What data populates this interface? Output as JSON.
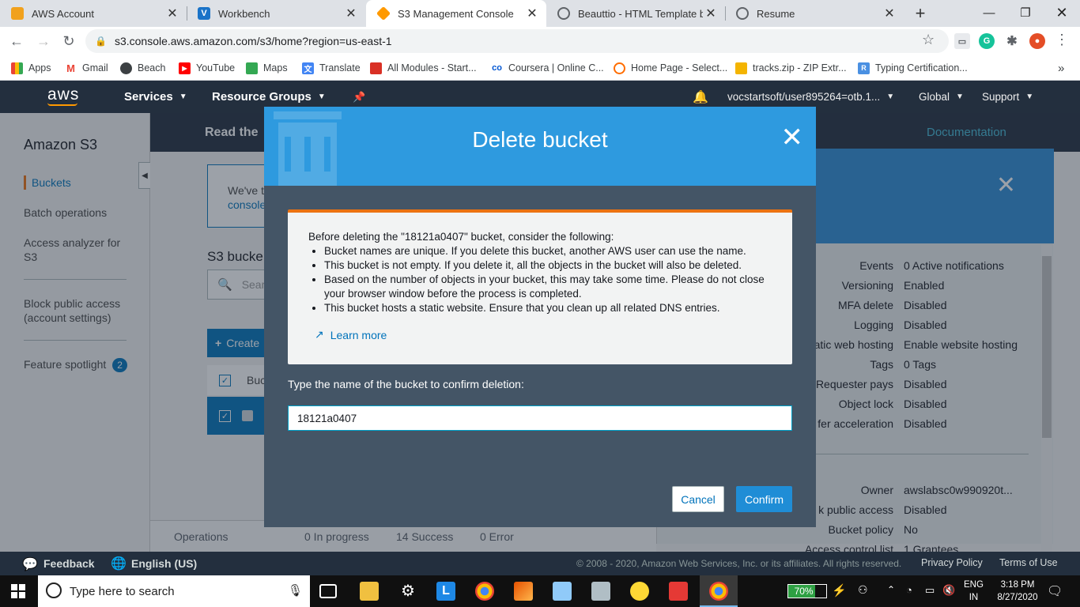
{
  "browser": {
    "tabs": [
      {
        "title": "AWS Account",
        "icon": "aws-cube-icon",
        "color": "#f1a11d"
      },
      {
        "title": "Workbench",
        "icon": "vocareum-icon",
        "color": "#1a73c8"
      },
      {
        "title": "S3 Management Console",
        "icon": "aws-cube-icon",
        "color": "#ff9900"
      },
      {
        "title": "Beauttio - HTML Template by V",
        "icon": "globe-icon",
        "color": "#5f6368"
      },
      {
        "title": "Resume",
        "icon": "globe-icon",
        "color": "#5f6368"
      }
    ],
    "new_tab": "+",
    "url": "s3.console.aws.amazon.com/s3/home?region=us-east-1",
    "bookmarks": [
      {
        "label": "Apps",
        "icon": "apps-grid-icon"
      },
      {
        "label": "Gmail",
        "icon": "gmail-icon"
      },
      {
        "label": "Beach",
        "icon": "globe-icon"
      },
      {
        "label": "YouTube",
        "icon": "youtube-icon"
      },
      {
        "label": "Maps",
        "icon": "maps-icon"
      },
      {
        "label": "Translate",
        "icon": "translate-icon"
      },
      {
        "label": "All Modules - Start...",
        "icon": "modules-icon"
      },
      {
        "label": "Coursera | Online C...",
        "icon": "coursera-icon"
      },
      {
        "label": "Home Page - Select...",
        "icon": "loading-icon"
      },
      {
        "label": "tracks.zip - ZIP Extr...",
        "icon": "zip-icon"
      },
      {
        "label": "Typing Certification...",
        "icon": "typing-icon"
      }
    ],
    "more_bookmarks": "»"
  },
  "aws_header": {
    "logo": "aws",
    "services": "Services",
    "resource_groups": "Resource Groups",
    "account": "vocstartsoft/user895264=otb.1...",
    "region": "Global",
    "support": "Support"
  },
  "sidebar": {
    "title": "Amazon S3",
    "items": [
      "Buckets",
      "Batch operations",
      "Access analyzer for S3",
      "Block public access (account settings)",
      "Feature spotlight"
    ],
    "spotlight_count": "2"
  },
  "main": {
    "banner_title": "Read the",
    "documentation": "Documentation",
    "notice_line1": "We've t",
    "notice_line2": "console",
    "buckets_heading": "S3 bucke",
    "search_placeholder": "Sear",
    "create_button": "Create",
    "col_bucket": "Buc"
  },
  "operations": {
    "label": "Operations",
    "in_progress": "0 In progress",
    "success": "14 Success",
    "error": "0 Error"
  },
  "properties_panel": {
    "rows": [
      {
        "label": "Events",
        "value": "0 Active notifications"
      },
      {
        "label": "Versioning",
        "value": "Enabled"
      },
      {
        "label": "MFA delete",
        "value": "Disabled"
      },
      {
        "label": "Logging",
        "value": "Disabled"
      },
      {
        "label": "atic web hosting",
        "value": "Enable website hosting"
      },
      {
        "label": "Tags",
        "value": "0 Tags"
      },
      {
        "label": "Requester pays",
        "value": "Disabled"
      },
      {
        "label": "Object lock",
        "value": "Disabled"
      },
      {
        "label": "fer acceleration",
        "value": "Disabled"
      }
    ],
    "rows2": [
      {
        "label": "Owner",
        "value": "awslabsc0w990920t..."
      },
      {
        "label": "k public access",
        "value": "Disabled"
      },
      {
        "label": "Bucket policy",
        "value": "No"
      },
      {
        "label": "Access control list",
        "value": "1 Grantees"
      }
    ]
  },
  "modal": {
    "title": "Delete bucket",
    "intro": "Before deleting the \"18121a0407\" bucket, consider the following:",
    "bullets": [
      "Bucket names are unique. If you delete this bucket, another AWS user can use the name.",
      "This bucket is not empty. If you delete it, all the objects in the bucket will also be deleted.",
      "Based on the number of objects in your bucket, this may take some time. Please do not close your browser window before the process is completed.",
      "This bucket hosts a static website. Ensure that you clean up all related DNS entries."
    ],
    "learn_more": "Learn more",
    "confirm_label": "Type the name of the bucket to confirm deletion:",
    "input_value": "18121a0407",
    "cancel": "Cancel",
    "confirm": "Confirm"
  },
  "footer": {
    "feedback": "Feedback",
    "language": "English (US)",
    "copyright": "© 2008 - 2020, Amazon Web Services, Inc. or its affiliates. All rights reserved.",
    "privacy": "Privacy Policy",
    "terms": "Terms of Use"
  },
  "taskbar": {
    "search_placeholder": "Type here to search",
    "battery": "70%",
    "lang1": "ENG",
    "lang2": "IN",
    "time": "3:18 PM",
    "date": "8/27/2020"
  },
  "colors": {
    "aws_dark": "#232f3e",
    "modal_blue": "#2e9adf",
    "accent_orange": "#ec7211",
    "confirm_blue": "#1f8dd6"
  }
}
